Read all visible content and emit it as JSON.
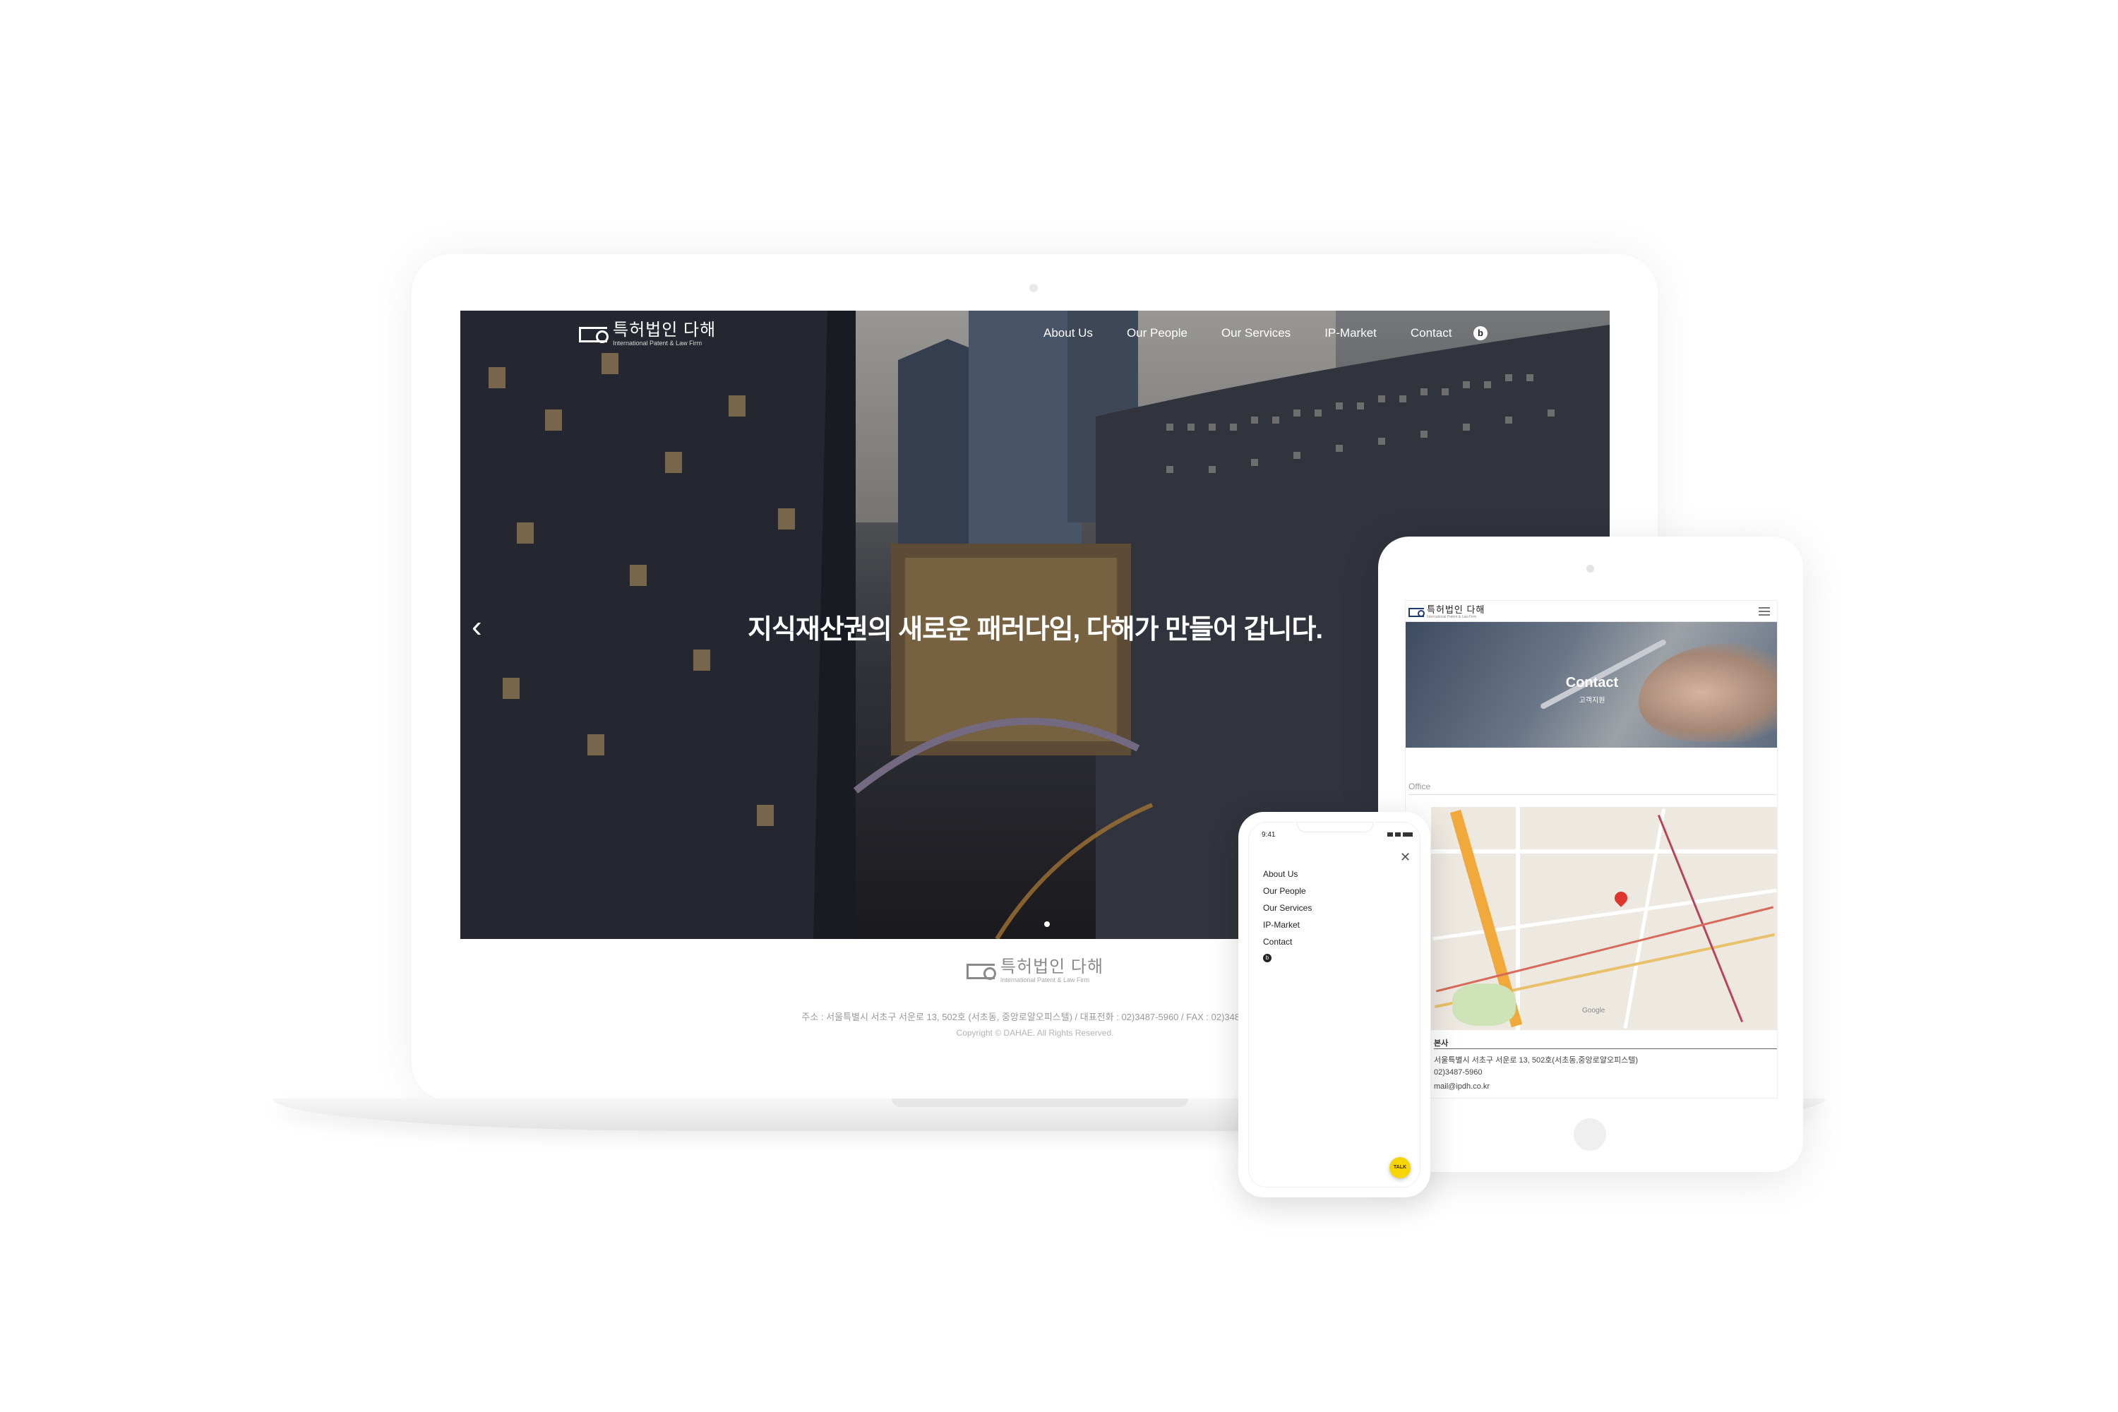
{
  "brand": {
    "name_kr": "특허법인 다해",
    "name_en": "International Patent & Law Firm"
  },
  "laptop": {
    "nav": [
      "About Us",
      "Our People",
      "Our Services",
      "IP-Market",
      "Contact"
    ],
    "nav_blog_icon": "b",
    "hero_headline": "지식재산권의 새로운 패러다임, 다해가 만들어 갑니다.",
    "hero_prev_glyph": "‹",
    "footer_address": "주소 : 서울특별시 서초구 서운로 13, 502호 (서초동, 중앙로얄오피스텔) / 대표전화 : 02)3487-5960 / FAX : 02)3487-5961",
    "footer_copyright": "Copyright © DAHAE. All Rights Reserved."
  },
  "tablet": {
    "banner_title": "Contact",
    "banner_subtitle": "고객지원",
    "office_label": "Office",
    "map_attribution": "Google",
    "zoom_in": "+",
    "zoom_out": "−",
    "info_title": "본사",
    "info_address": "서울특별시 서초구 서운로 13, 502호(서초동,중앙로얄오피스텔)",
    "info_phone": "02)3487-5960",
    "info_email": "mail@ipdh.co.kr"
  },
  "phone": {
    "time": "9:41",
    "close_glyph": "✕",
    "menu": [
      "About Us",
      "Our People",
      "Our Services",
      "IP-Market",
      "Contact"
    ],
    "blog_icon": "b",
    "talk_label": "TALK"
  },
  "colors": {
    "kakao_yellow": "#f7d500",
    "map_pin": "#e0342d",
    "brand_navy": "#1e3a6e"
  }
}
